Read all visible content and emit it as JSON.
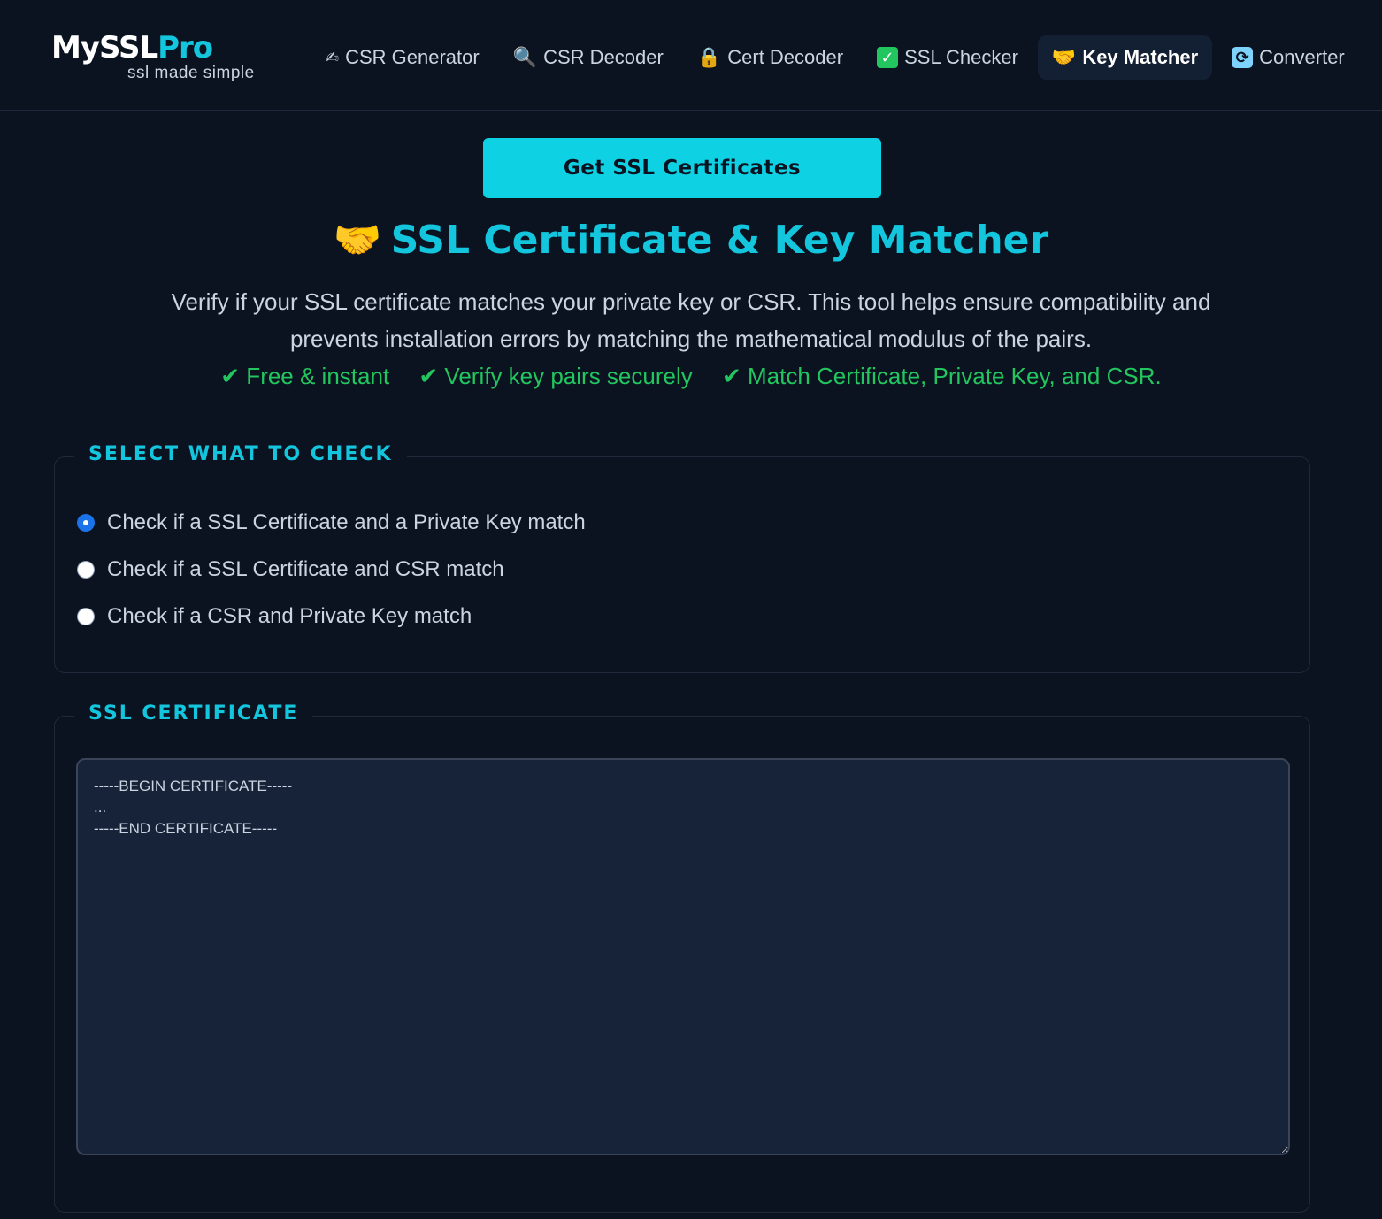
{
  "brand": {
    "name_main": "MySSL",
    "name_accent": "Pro",
    "tagline": "ssl made simple",
    "accent_color": "#14c6dd"
  },
  "nav": {
    "items": [
      {
        "icon": "writing-hand-icon",
        "glyph": "✍",
        "label": "CSR Generator",
        "active": false
      },
      {
        "icon": "magnifier-icon",
        "glyph": "🔍",
        "label": "CSR Decoder",
        "active": false
      },
      {
        "icon": "lock-icon",
        "glyph": "🔒",
        "label": "Cert Decoder",
        "active": false
      },
      {
        "icon": "check-box-icon",
        "glyph": "✓",
        "label": "SSL Checker",
        "active": false
      },
      {
        "icon": "handshake-icon",
        "glyph": "🤝",
        "label": "Key Matcher",
        "active": true
      },
      {
        "icon": "convert-arrows-icon",
        "glyph": "⟳",
        "label": "Converter",
        "active": false
      }
    ]
  },
  "hero": {
    "cta_label": "Get SSL Certificates",
    "title_emoji": "🤝",
    "title": "SSL Certificate & Key Matcher",
    "description": "Verify if your SSL certificate matches your private key or CSR. This tool helps ensure compatibility and prevents installation errors by matching the mathematical modulus of the pairs.",
    "features": [
      "✔ Free & instant",
      "✔ Verify key pairs securely",
      "✔ Match Certificate, Private Key, and CSR."
    ],
    "feature_color": "#22c55e"
  },
  "select_section": {
    "legend": "SELECT WHAT TO CHECK",
    "options": [
      {
        "label": "Check if a SSL Certificate and a Private Key match",
        "checked": true
      },
      {
        "label": "Check if a SSL Certificate and CSR match",
        "checked": false
      },
      {
        "label": "Check if a CSR and Private Key match",
        "checked": false
      }
    ]
  },
  "cert_section": {
    "legend": "SSL CERTIFICATE",
    "placeholder": "-----BEGIN CERTIFICATE-----\n...\n-----END CERTIFICATE-----",
    "value": ""
  },
  "colors": {
    "background": "#0b1220",
    "cta": "#0ed2e4",
    "radio_selected": "#1a73e8"
  }
}
